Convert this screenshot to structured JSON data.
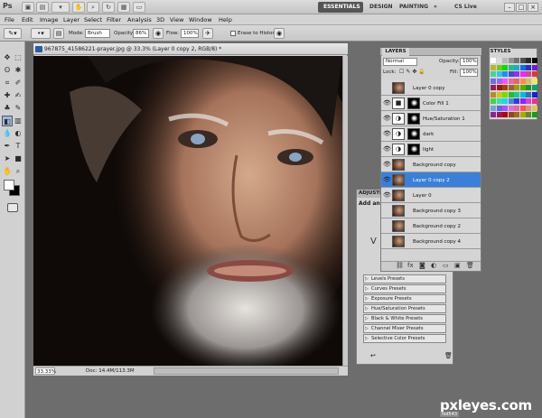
{
  "app": {
    "logo": "Ps",
    "workspaces": [
      "ESSENTIALS",
      "DESIGN",
      "PAINTING"
    ],
    "more_glyph": "»",
    "cs_live": "CS Live",
    "window_controls": [
      "–",
      "□",
      "×"
    ]
  },
  "menu": [
    "File",
    "Edit",
    "Image",
    "Layer",
    "Select",
    "Filter",
    "Analysis",
    "3D",
    "View",
    "Window",
    "Help"
  ],
  "options": {
    "mode_label": "Mode:",
    "mode_value": "Brush",
    "opacity_label": "Opacity:",
    "opacity_value": "86%",
    "flow_label": "Flow:",
    "flow_value": "100%",
    "erase_history_label": "Erase to History"
  },
  "document": {
    "title": "967875_41586221-prayer.jpg @ 33.3% (Layer 0 copy 2, RGB/8) *",
    "zoom": "33.33%",
    "doc_size": "Doc: 14.4M/113.3M"
  },
  "layers_panel": {
    "tab": "LAYERS",
    "blend_mode": "Normal",
    "opacity_label": "Opacity:",
    "opacity_value": "100%",
    "lock_label": "Lock:",
    "fill_label": "Fill:",
    "fill_value": "100%",
    "layers": [
      {
        "name": "Layer 0 copy",
        "visible": false,
        "kind": "photo",
        "selected": false
      },
      {
        "name": "Color Fill 1",
        "visible": true,
        "kind": "fill-mask",
        "selected": false
      },
      {
        "name": "Hue/Saturation 1",
        "visible": true,
        "kind": "adjust-mask",
        "selected": false
      },
      {
        "name": "dark",
        "visible": true,
        "kind": "adjust-mask",
        "selected": false
      },
      {
        "name": "light",
        "visible": true,
        "kind": "adjust-mask",
        "selected": false
      },
      {
        "name": "Background copy",
        "visible": true,
        "kind": "photo",
        "selected": false
      },
      {
        "name": "Layer 0 copy 2",
        "visible": true,
        "kind": "photo",
        "selected": true
      },
      {
        "name": "Layer 0",
        "visible": true,
        "kind": "photo",
        "selected": false
      },
      {
        "name": "Background copy 3",
        "visible": false,
        "kind": "photo",
        "selected": false
      },
      {
        "name": "Background copy 2",
        "visible": false,
        "kind": "photo",
        "selected": false
      },
      {
        "name": "Background copy 4",
        "visible": false,
        "kind": "photo",
        "selected": false
      }
    ]
  },
  "adjustments_panel": {
    "tab": "ADJUSTM",
    "add_label": "Add an a",
    "presets": [
      "Levels Presets",
      "Curves Presets",
      "Exposure Presets",
      "Hue/Saturation Presets",
      "Black & White Presets",
      "Channel Mixer Presets",
      "Selective Color Presets"
    ]
  },
  "styles_panel": {
    "tab": "STYLES"
  },
  "watermark": {
    "text": "pxleyes.com",
    "sub": "fsd543"
  },
  "colors": {
    "accent": "#3b7fd8",
    "panel": "#d4d4d4",
    "chrome": "#c4c4c4"
  }
}
